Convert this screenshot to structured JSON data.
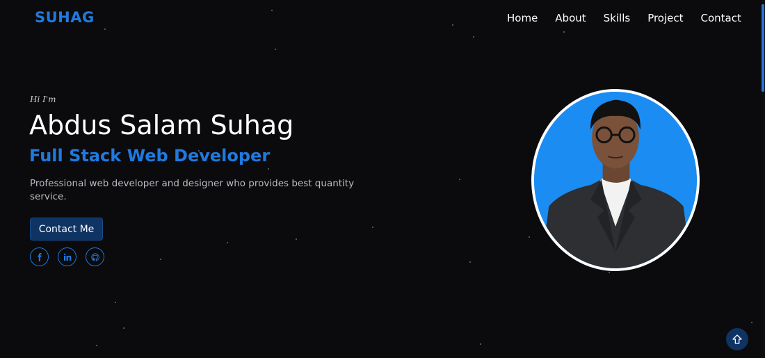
{
  "nav": {
    "logo": "SUHAG",
    "links": [
      "Home",
      "About",
      "Skills",
      "Project",
      "Contact"
    ]
  },
  "hero": {
    "greeting": "Hi I'm",
    "name": "Abdus Salam Suhag",
    "role": "Full Stack Web Developer",
    "description": "Professional web developer and designer who provides best quantity service.",
    "cta_label": "Contact Me",
    "socials": [
      {
        "icon": "facebook-icon"
      },
      {
        "icon": "linkedin-icon"
      },
      {
        "icon": "github-icon"
      }
    ]
  },
  "back_to_top": {
    "icon": "arrow-up-icon"
  },
  "colors": {
    "background": "#0b0b0d",
    "accent": "#1f7ae0",
    "button": "#0f3363",
    "portrait_bg": "#1b8cf2"
  }
}
